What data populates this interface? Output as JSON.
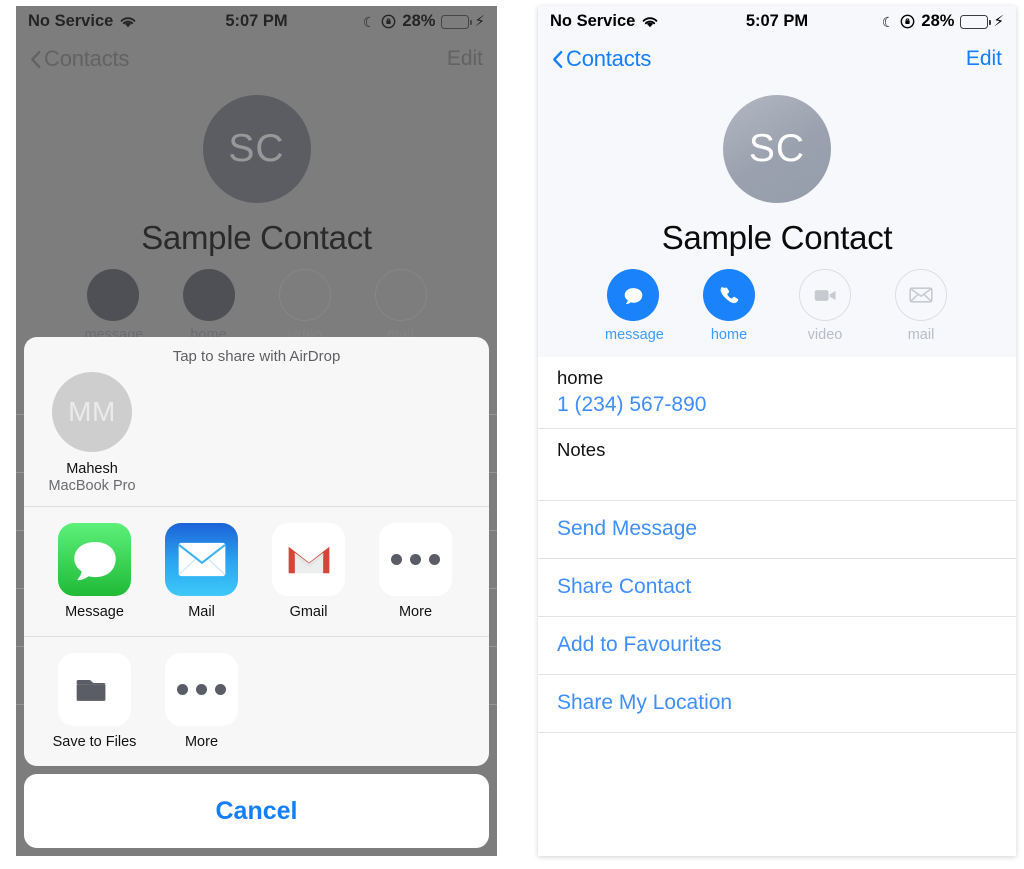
{
  "status_bar": {
    "carrier": "No Service",
    "wifi_icon": "wifi-icon",
    "time": "5:07 PM",
    "moon_icon": "do-not-disturb-moon-icon",
    "rotation_lock_icon": "rotation-lock-icon",
    "battery_percent": "28%",
    "battery_level": 28,
    "battery_color": "#4cd964",
    "charging_icon": "lightning-bolt-icon"
  },
  "nav": {
    "back_icon": "chevron-left-icon",
    "back_label": "Contacts",
    "edit_label": "Edit"
  },
  "contact": {
    "avatar_initials": "SC",
    "name": "Sample Contact",
    "actions": [
      {
        "label": "message",
        "icon": "message-bubble-icon",
        "enabled": true
      },
      {
        "label": "home",
        "icon": "phone-handset-icon",
        "enabled": true
      },
      {
        "label": "video",
        "icon": "video-camera-icon",
        "enabled": false
      },
      {
        "label": "mail",
        "icon": "envelope-icon",
        "enabled": false
      }
    ],
    "fields": [
      {
        "label": "home",
        "value": "1 (234) 567-890"
      },
      {
        "label": "Notes",
        "value": ""
      }
    ],
    "links": [
      "Send Message",
      "Share Contact",
      "Add to Favourites",
      "Share My Location"
    ]
  },
  "share_sheet": {
    "airdrop_title": "Tap to share with AirDrop",
    "airdrop_target": {
      "initials": "MM",
      "name": "Mahesh",
      "device": "MacBook Pro"
    },
    "apps": [
      {
        "label": "Message",
        "icon": "messages-app-icon"
      },
      {
        "label": "Mail",
        "icon": "mail-app-icon"
      },
      {
        "label": "Gmail",
        "icon": "gmail-app-icon"
      },
      {
        "label": "More",
        "icon": "more-ellipsis-icon"
      }
    ],
    "actions": [
      {
        "label": "Save to Files",
        "icon": "folder-icon"
      },
      {
        "label": "More",
        "icon": "more-ellipsis-icon"
      }
    ],
    "cancel_label": "Cancel"
  },
  "colors": {
    "accent_blue": "#157efb",
    "link_blue": "#3e8ffd",
    "battery_green": "#4cd964",
    "dim_gray": "#9a9a9a"
  }
}
